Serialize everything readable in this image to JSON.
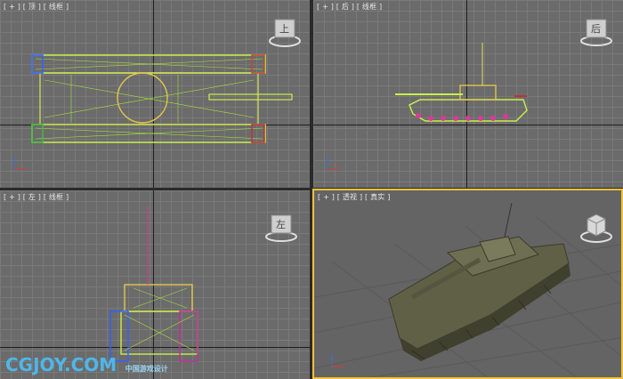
{
  "viewports": {
    "top": {
      "label": "[ + ] [ 顶 ] [ 线框 ]",
      "cube": "上"
    },
    "front": {
      "label": "[ + ] [ 后 ] [ 线框 ]",
      "cube": "后"
    },
    "left": {
      "label": "[ + ] [ 左 ] [ 线框 ]",
      "cube": "左"
    },
    "perspective": {
      "label": "[ + ] [ 透视 ] [ 真实 ]"
    }
  },
  "watermark": {
    "text": "CGJOY.COM",
    "sub": "中国游戏设计"
  },
  "colors": {
    "accent": "#f2c23a",
    "wire": "#c9f04a",
    "tank": "#5f6046"
  }
}
